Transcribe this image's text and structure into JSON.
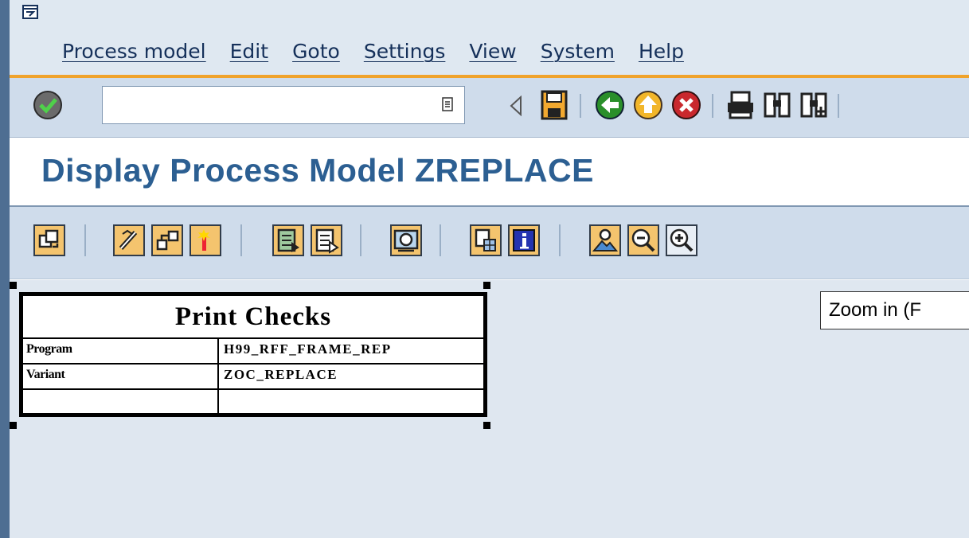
{
  "menu": {
    "items": [
      {
        "label": "Process model"
      },
      {
        "label": "Edit"
      },
      {
        "label": "Goto"
      },
      {
        "label": "Settings"
      },
      {
        "label": "View"
      },
      {
        "label": "System"
      },
      {
        "label": "Help"
      }
    ]
  },
  "command_field": {
    "value": ""
  },
  "page": {
    "title": "Display Process Model ZREPLACE"
  },
  "node": {
    "title": "Print Checks",
    "rows": [
      {
        "key": "Program",
        "value": "H99_RFF_FRAME_REP"
      },
      {
        "key": "Variant",
        "value": "ZOC_REPLACE"
      },
      {
        "key": "",
        "value": ""
      }
    ]
  },
  "tooltip": {
    "text": "Zoom in   (F"
  },
  "colors": {
    "accent_orange": "#f0a32c",
    "title_blue": "#2c5f92",
    "frame_blue": "#4e6e92"
  }
}
